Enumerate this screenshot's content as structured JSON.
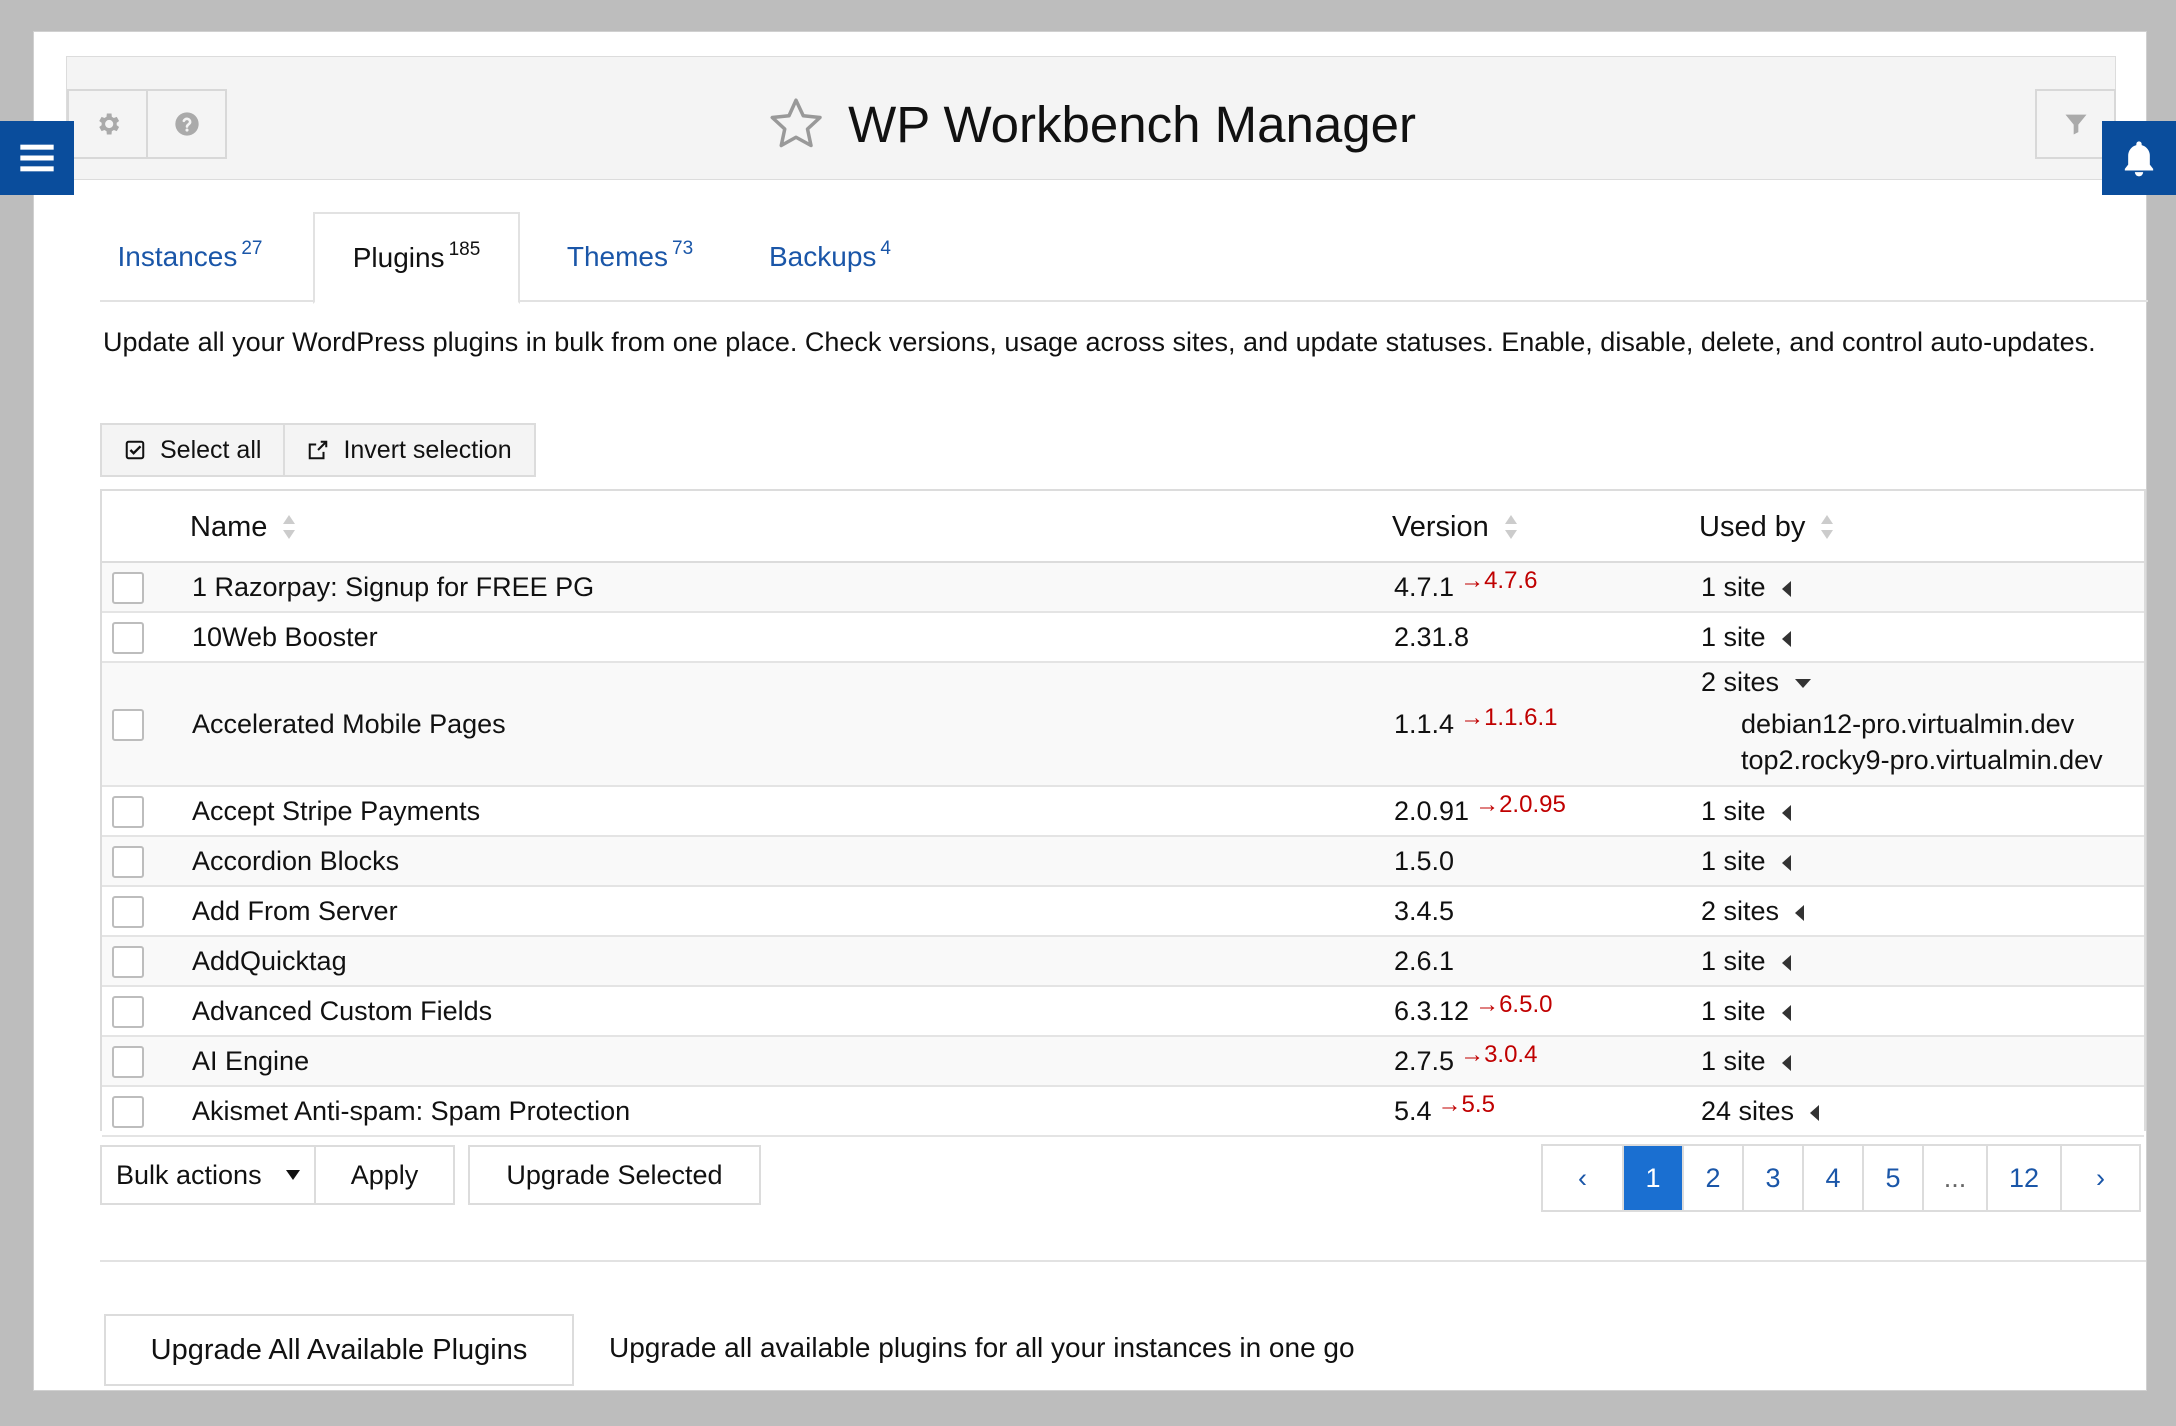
{
  "header": {
    "title": "WP Workbench Manager",
    "icons": [
      "gear-icon",
      "help-icon",
      "star-icon",
      "filter-icon",
      "menu-icon",
      "bell-icon"
    ]
  },
  "tabs": [
    {
      "label": "Instances",
      "count": "27"
    },
    {
      "label": "Plugins",
      "count": "185"
    },
    {
      "label": "Themes",
      "count": "73"
    },
    {
      "label": "Backups",
      "count": "4"
    }
  ],
  "description": "Update all your WordPress plugins in bulk from one place. Check versions, usage across sites, and update statuses. Enable, disable, delete, and control auto-updates.",
  "selection": {
    "select_all": "Select all",
    "invert": "Invert selection"
  },
  "table": {
    "columns": {
      "name": "Name",
      "version": "Version",
      "used_by": "Used by"
    },
    "rows": [
      {
        "name": "1 Razorpay: Signup for FREE PG",
        "version": "4.7.1",
        "update": "→4.7.6",
        "used_by": "1 site",
        "expanded": false,
        "sites": []
      },
      {
        "name": "10Web Booster",
        "version": "2.31.8",
        "update": "",
        "used_by": "1 site",
        "expanded": false,
        "sites": []
      },
      {
        "name": "Accelerated Mobile Pages",
        "version": "1.1.4",
        "update": "→1.1.6.1",
        "used_by": "2 sites",
        "expanded": true,
        "sites": [
          "debian12-pro.virtualmin.dev",
          "top2.rocky9-pro.virtualmin.dev"
        ]
      },
      {
        "name": "Accept Stripe Payments",
        "version": "2.0.91",
        "update": "→2.0.95",
        "used_by": "1 site",
        "expanded": false,
        "sites": []
      },
      {
        "name": "Accordion Blocks",
        "version": "1.5.0",
        "update": "",
        "used_by": "1 site",
        "expanded": false,
        "sites": []
      },
      {
        "name": "Add From Server",
        "version": "3.4.5",
        "update": "",
        "used_by": "2 sites",
        "expanded": false,
        "sites": []
      },
      {
        "name": "AddQuicktag",
        "version": "2.6.1",
        "update": "",
        "used_by": "1 site",
        "expanded": false,
        "sites": []
      },
      {
        "name": "Advanced Custom Fields",
        "version": "6.3.12",
        "update": "→6.5.0",
        "used_by": "1 site",
        "expanded": false,
        "sites": []
      },
      {
        "name": "AI Engine",
        "version": "2.7.5",
        "update": "→3.0.4",
        "used_by": "1 site",
        "expanded": false,
        "sites": []
      },
      {
        "name": "Akismet Anti-spam: Spam Protection",
        "version": "5.4",
        "update": "→5.5",
        "used_by": "24 sites",
        "expanded": false,
        "sites": []
      }
    ]
  },
  "bulk": {
    "select_label": "Bulk actions",
    "apply": "Apply",
    "upgrade_selected": "Upgrade Selected"
  },
  "pagination": {
    "prev": "‹",
    "pages": [
      "1",
      "2",
      "3",
      "4",
      "5",
      "...",
      "12"
    ],
    "current": "1",
    "next": "›"
  },
  "footer": {
    "upgrade_all": "Upgrade All Available Plugins",
    "upgrade_all_desc": "Upgrade all available plugins for all your instances in one go"
  },
  "colors": {
    "accent": "#1a56a8",
    "nav_tab": "#0a4d9c",
    "active_page": "#1a6fd1",
    "update": "#c00000"
  }
}
